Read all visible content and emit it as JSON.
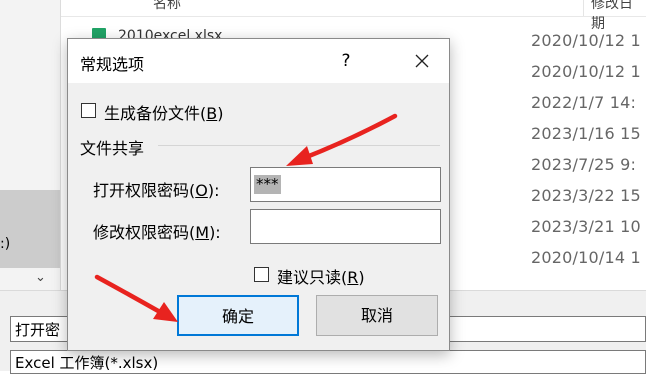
{
  "background": {
    "header": {
      "name": "名称",
      "date": "修改日期"
    },
    "file_visible_name": "2010excel.xlsx",
    "dates": [
      "2020/10/12 1",
      "2020/10/12 1",
      "2022/1/7 14:",
      "2023/1/16 15",
      "2023/7/25 9:",
      "2023/3/22 15",
      "2023/3/21 10",
      "2020/10/14 1"
    ],
    "left_partial": ":)",
    "file_name_value": "打开密",
    "file_type_value": "Excel 工作簿(*.xlsx)",
    "colors": {
      "excel_icon": "#21a366"
    }
  },
  "dialog": {
    "title": "常规选项",
    "help_label": "?",
    "close_label": "✕",
    "backup": {
      "label": "生成备份文件(",
      "key": "B",
      "tail": ")",
      "checked": false
    },
    "section_title": "文件共享",
    "open_password": {
      "label": "打开权限密码(",
      "key": "O",
      "tail": "):",
      "value": "***"
    },
    "modify_password": {
      "label": "修改权限密码(",
      "key": "M",
      "tail": "):",
      "value": ""
    },
    "readonly": {
      "label": "建议只读(",
      "key": "R",
      "tail": ")",
      "checked": false
    },
    "ok_label": "确定",
    "cancel_label": "取消",
    "colors": {
      "accent": "#0078d7",
      "annotation": "#e8231f"
    }
  }
}
